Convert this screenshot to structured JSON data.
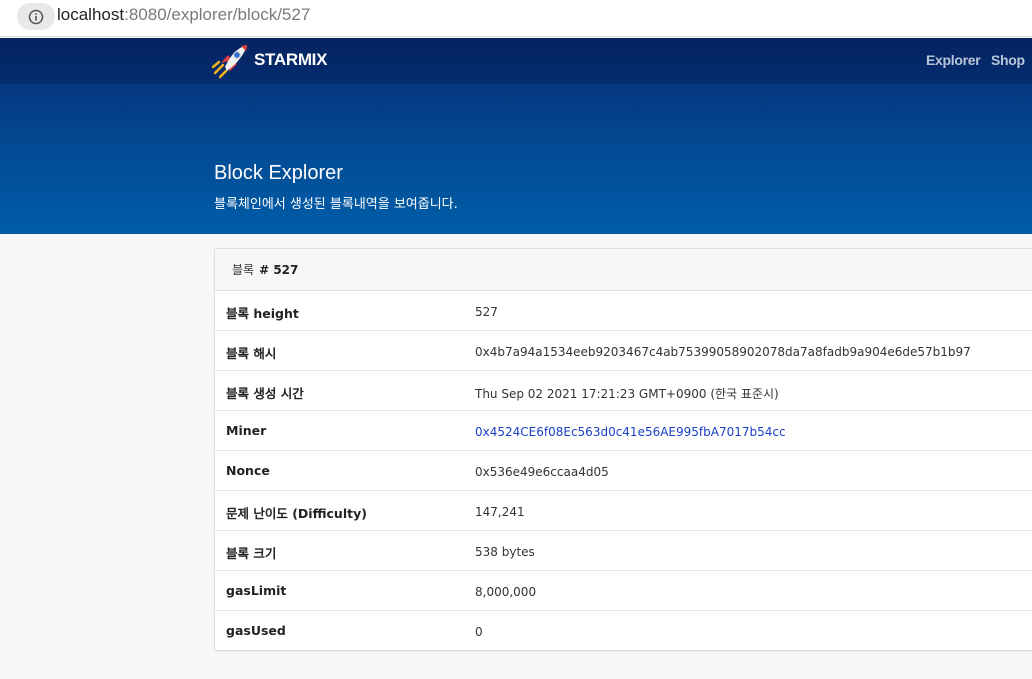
{
  "browser": {
    "url_host": "localhost",
    "url_rest": ":8080/explorer/block/527",
    "info_icon": "info-icon"
  },
  "nav": {
    "brand": "STARMIX",
    "logo_icon": "rocket-icon",
    "links": [
      "Explorer",
      "Shop"
    ]
  },
  "hero": {
    "title": "Block Explorer",
    "subtitle": "블록체인에서 생성된 블록내역을 보여줍니다."
  },
  "card": {
    "header_label": "블록",
    "header_number": "# 527",
    "rows": [
      {
        "label": "블록 height",
        "value": "527"
      },
      {
        "label": "블록 해시",
        "value": "0x4b7a94a1534eeb9203467c4ab75399058902078da7a8fadb9a904e6de57b1b97"
      },
      {
        "label": "블록 생성 시간",
        "value": "Thu Sep 02 2021 17:21:23 GMT+0900 (한국 표준시)"
      },
      {
        "label": "Miner",
        "value": "0x4524CE6f08Ec563d0c41e56AE995fbA7017b54cc"
      },
      {
        "label": "Nonce",
        "value": "0x536e49e6ccaa4d05"
      },
      {
        "label": "문제 난이도 (Difficulty)",
        "value": "147,241"
      },
      {
        "label": "블록 크기",
        "value": "538 bytes"
      },
      {
        "label": "gasLimit",
        "value": "8,000,000"
      },
      {
        "label": "gasUsed",
        "value": "0"
      }
    ]
  },
  "colors": {
    "header_dark": "#05235f",
    "hero_bottom": "#005da8",
    "link": "#1a3fc9"
  }
}
